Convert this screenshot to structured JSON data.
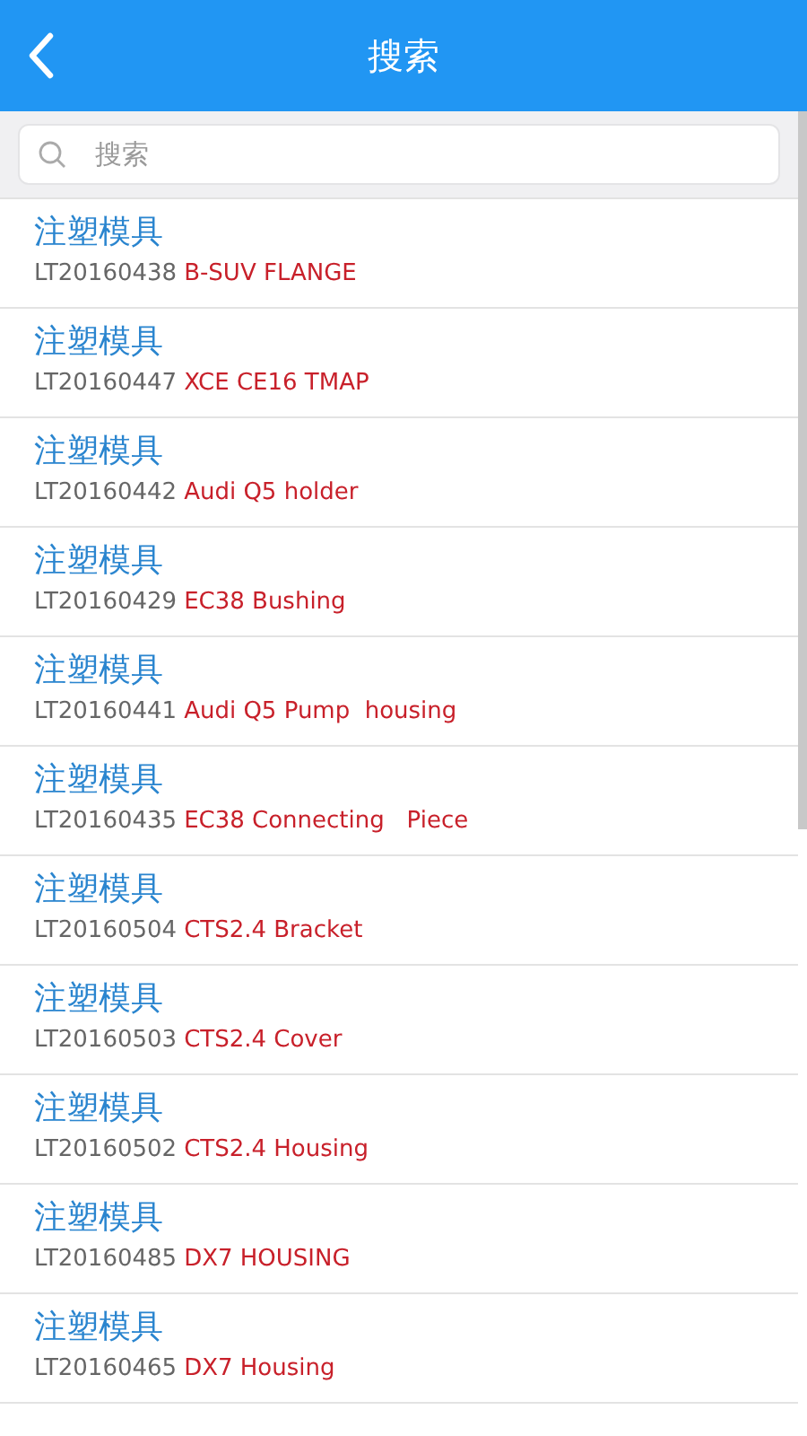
{
  "header": {
    "title": "搜索"
  },
  "search": {
    "placeholder": "搜索"
  },
  "items": [
    {
      "category": "注塑模具",
      "code": "LT20160438",
      "name": "B-SUV FLANGE"
    },
    {
      "category": "注塑模具",
      "code": "LT20160447",
      "name": "XCE CE16 TMAP"
    },
    {
      "category": "注塑模具",
      "code": "LT20160442",
      "name": "Audi Q5 holder"
    },
    {
      "category": "注塑模具",
      "code": "LT20160429",
      "name": "EC38 Bushing"
    },
    {
      "category": "注塑模具",
      "code": "LT20160441",
      "name": "Audi Q5 Pump  housing"
    },
    {
      "category": "注塑模具",
      "code": "LT20160435",
      "name": "EC38 Connecting   Piece"
    },
    {
      "category": "注塑模具",
      "code": "LT20160504",
      "name": "CTS2.4 Bracket"
    },
    {
      "category": "注塑模具",
      "code": "LT20160503",
      "name": "CTS2.4 Cover"
    },
    {
      "category": "注塑模具",
      "code": "LT20160502",
      "name": "CTS2.4 Housing"
    },
    {
      "category": "注塑模具",
      "code": "LT20160485",
      "name": "DX7 HOUSING"
    },
    {
      "category": "注塑模具",
      "code": "LT20160465",
      "name": "DX7 Housing"
    }
  ]
}
